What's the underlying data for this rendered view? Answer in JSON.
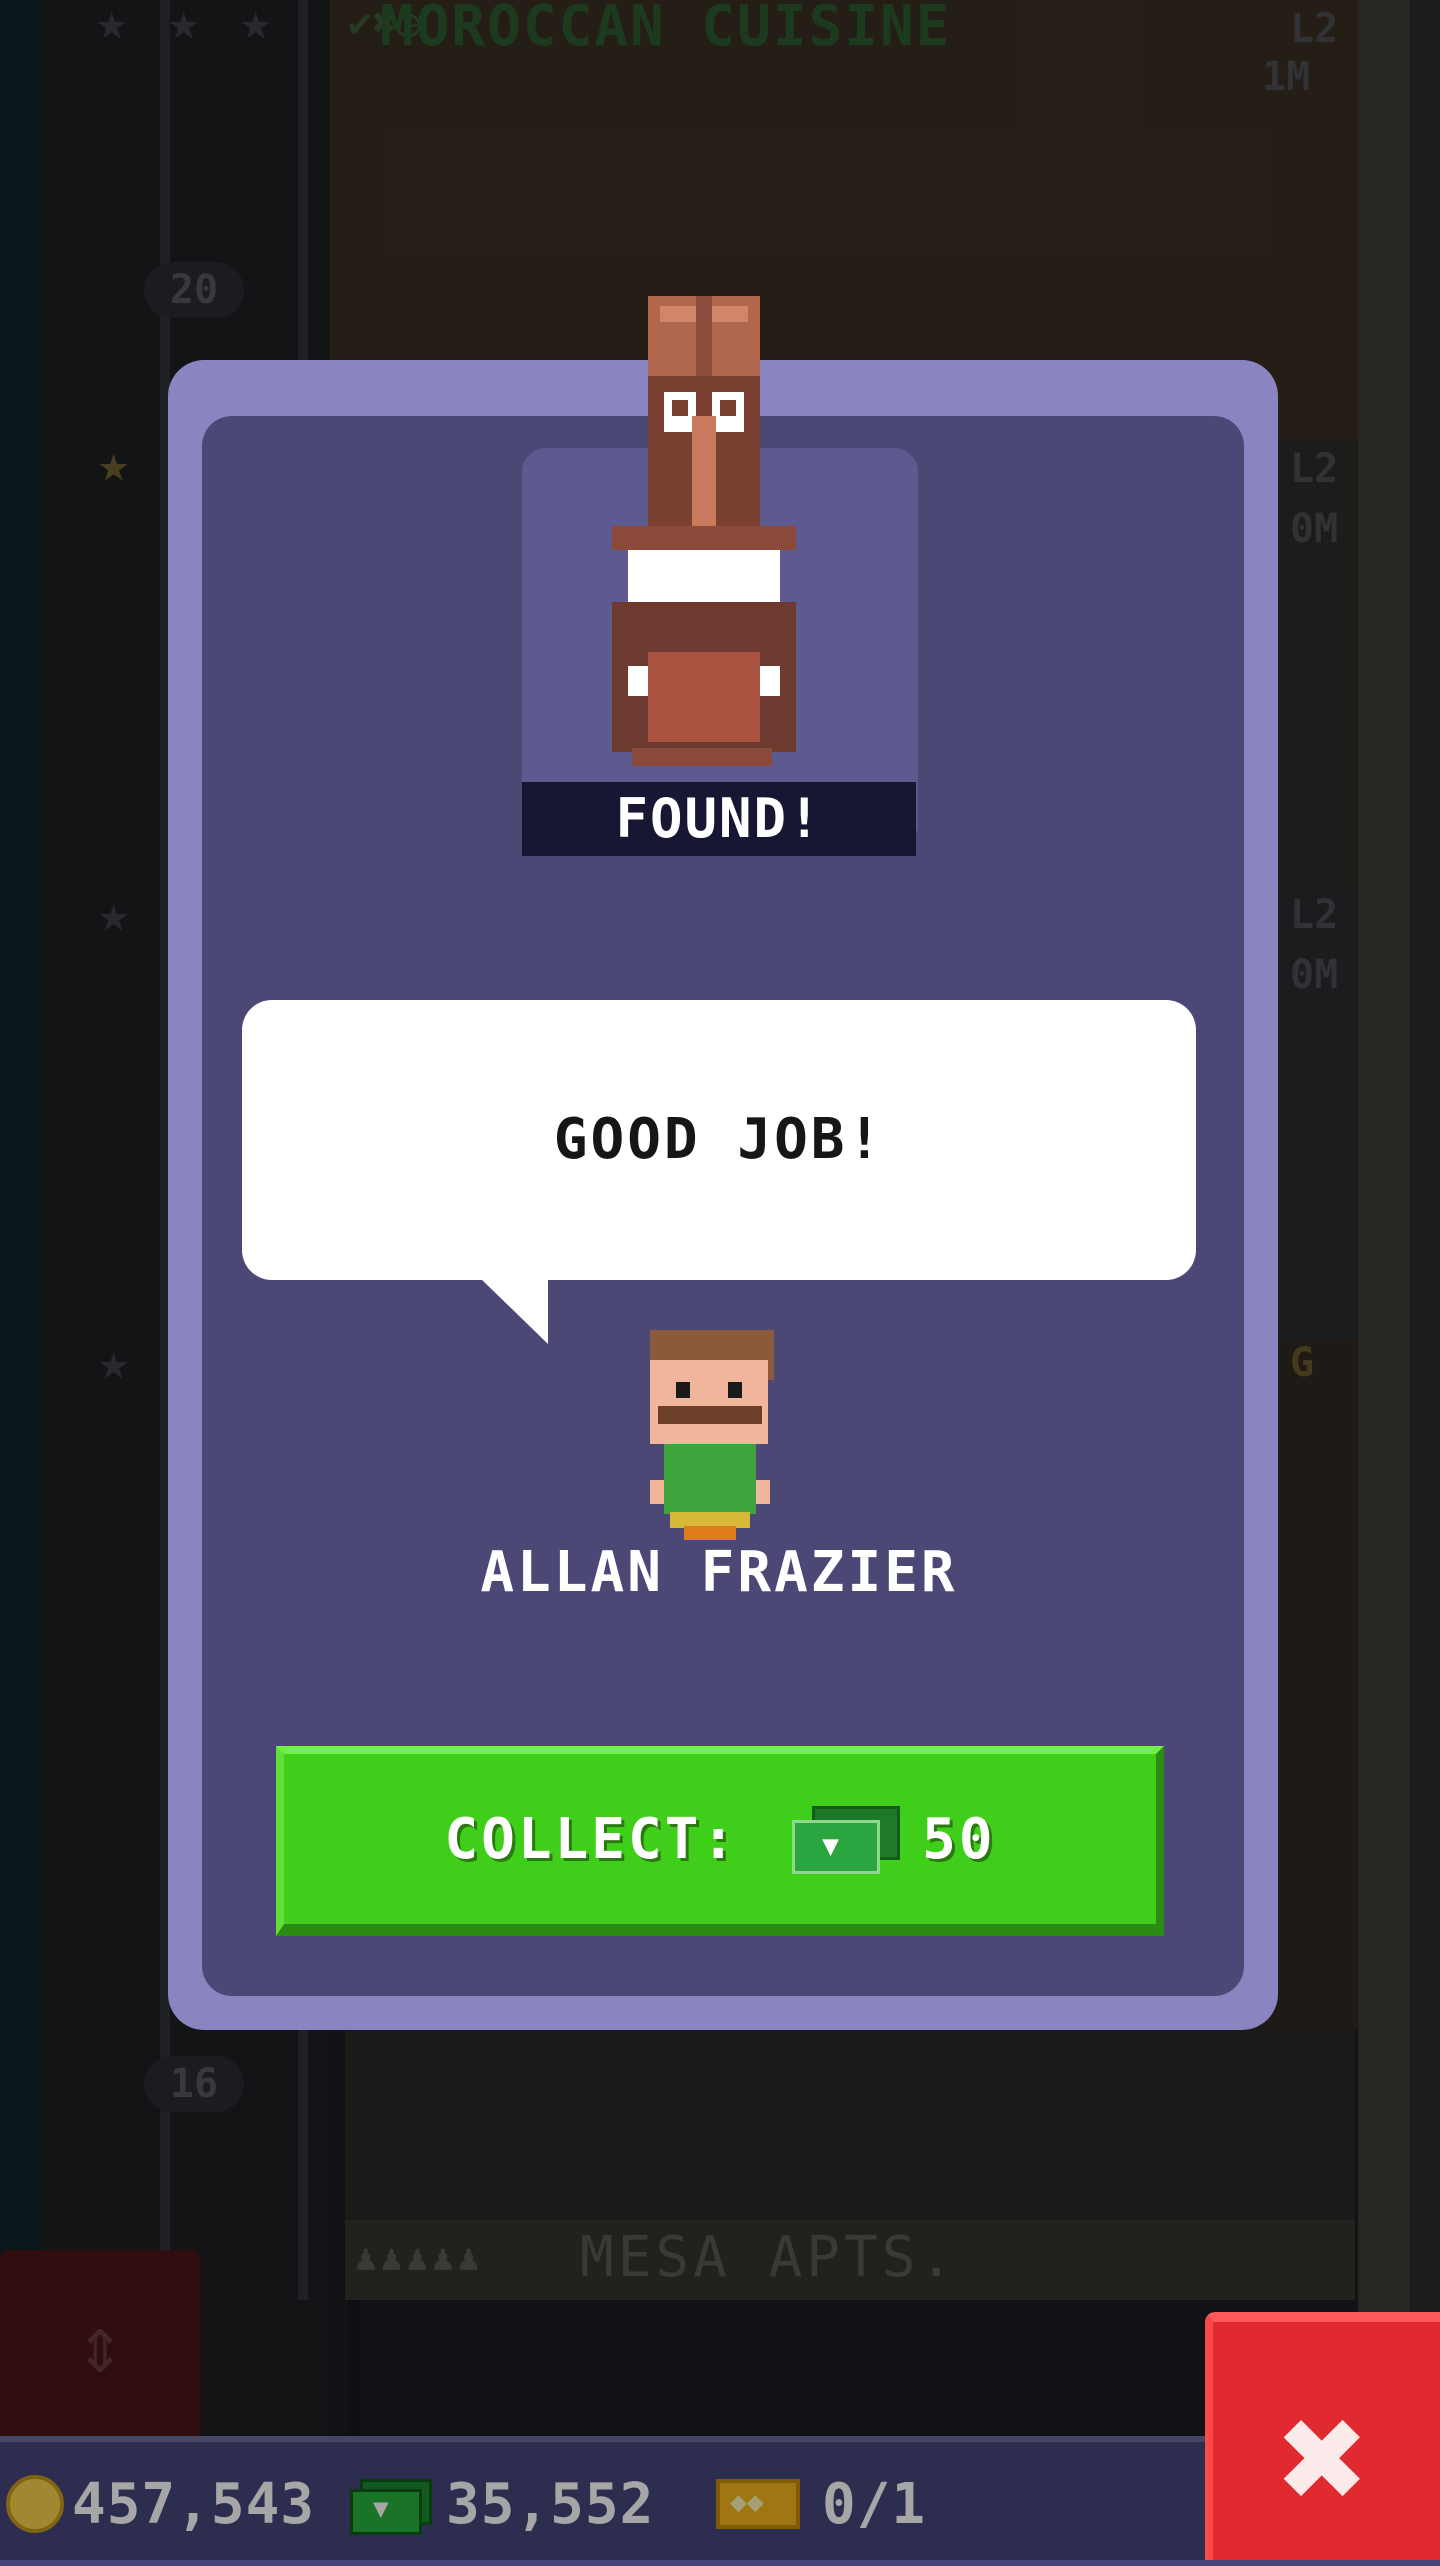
{
  "background": {
    "floor_name": "MOROCCAN CUISINE",
    "floor_levels": [
      "L2",
      "1M",
      "L2",
      "0M",
      "L2",
      "0M",
      "G"
    ],
    "shaft_numbers": [
      "20",
      "16"
    ],
    "lower_floor_name": "MESA APTS."
  },
  "modal": {
    "found_label": "FOUND!",
    "speech_text": "GOOD JOB!",
    "bitizen_name": "ALLAN FRAZIER",
    "collect_label": "COLLECT:",
    "collect_amount": "50"
  },
  "hud": {
    "coins": "457,543",
    "bux": "35,552",
    "tickets": "0/1"
  },
  "colors": {
    "modal_border": "#8a84c0",
    "modal_fill": "#4b4875",
    "collect_green": "#3fcf1a",
    "close_red": "#e02a2f",
    "hud_bg": "#44467a"
  },
  "icons": {
    "coin": "coin-icon",
    "bux": "bux-icon",
    "ticket": "ticket-icon",
    "close": "close-icon",
    "elevator": "up-down-arrows-icon"
  }
}
